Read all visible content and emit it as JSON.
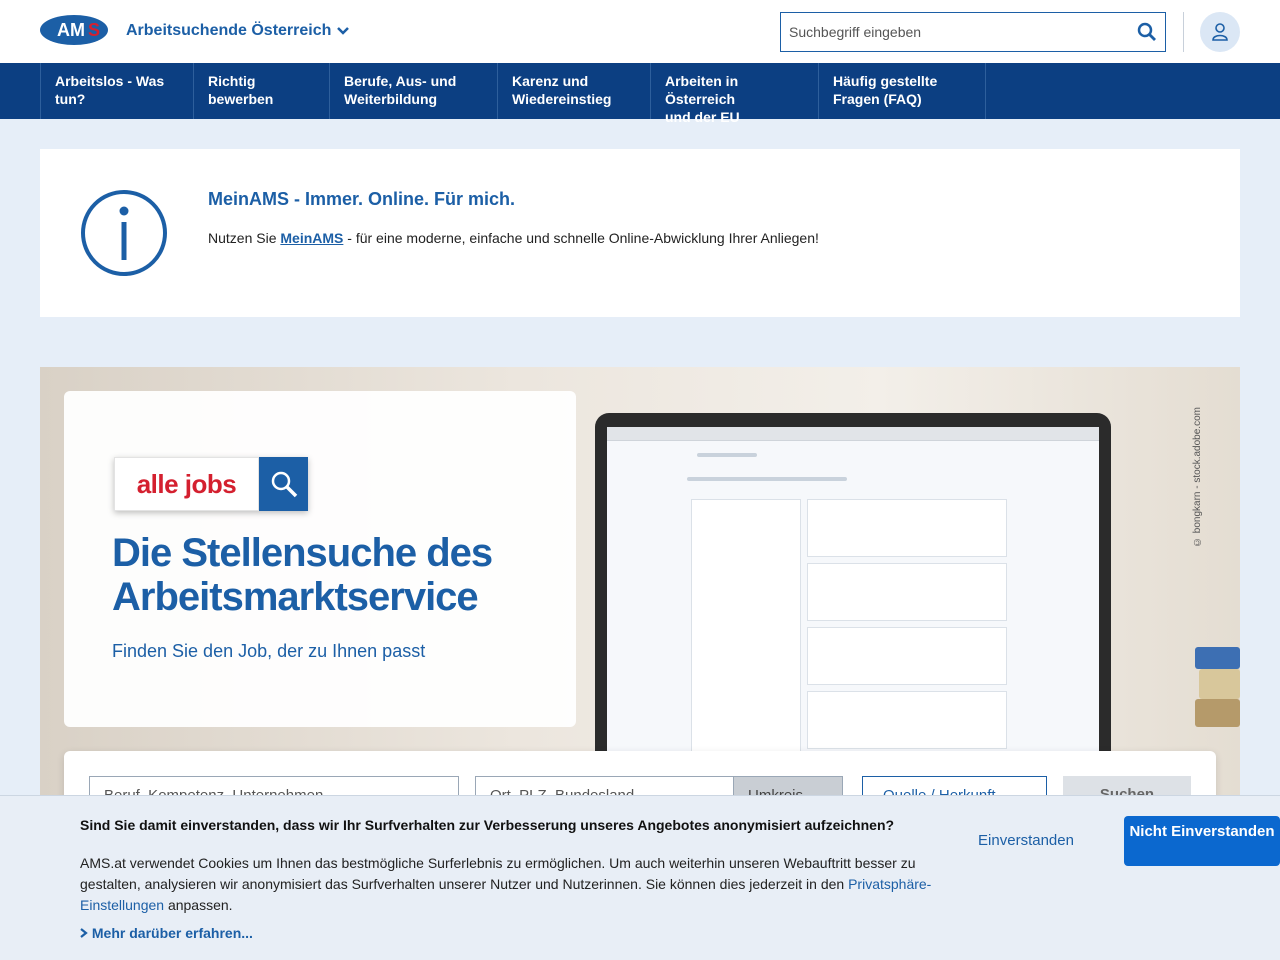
{
  "header": {
    "logo_text": "AMS",
    "region_label": "Arbeitsuchende Österreich",
    "search_placeholder": "Suchbegriff eingeben"
  },
  "nav": {
    "items": [
      {
        "line1": "Arbeitslos - Was",
        "line2": "tun?"
      },
      {
        "line1": "Richtig",
        "line2": "bewerben"
      },
      {
        "line1": "Berufe, Aus- und",
        "line2": "Weiterbildung"
      },
      {
        "line1": "Karenz und",
        "line2": "Wiedereinstieg"
      },
      {
        "line1": "Arbeiten in Österreich",
        "line2": "und der EU"
      },
      {
        "line1": "Häufig gestellte",
        "line2": "Fragen (FAQ)"
      }
    ]
  },
  "info": {
    "title": "MeinAMS - Immer. Online. Für mich.",
    "text_before": "Nutzen Sie ",
    "link": "MeinAMS",
    "text_after": " - für eine moderne, einfache und schnelle Online-Abwicklung Ihrer Anliegen!"
  },
  "hero": {
    "logo_text": "alle jobs",
    "headline": "Die Stellensuche des Arbeitsmarktservice",
    "tagline": "Finden Sie den Job, der zu Ihnen passt",
    "photo_credit": "© bongkarn - stock.adobe.com"
  },
  "jobsearch": {
    "keyword_placeholder": "Beruf, Kompetenz, Unternehmen",
    "location_placeholder": "Ort, PLZ, Bundesland",
    "radius_label": "Umkreis",
    "source_label": "Quelle / Herkunft",
    "search_button": "Suchen"
  },
  "cookie": {
    "question": "Sind Sie damit einverstanden, dass wir Ihr Surfverhalten zur Verbesserung unseres Angebotes anonymisiert aufzeichnen?",
    "text_before": "AMS.at verwendet Cookies um Ihnen das bestmögliche Surferlebnis zu  ermöglichen. Um auch weiterhin unseren Webauftritt besser zu gestalten, analysieren wir anonymisiert das Surfverhalten unserer Nutzer und  Nutzerinnen. Sie können dies jederzeit in den ",
    "link": "Privatsphäre-Einstellungen",
    "text_after": " anpassen.",
    "more": "Mehr darüber erfahren...",
    "accept": "Einverstanden",
    "decline": "Nicht Einverstanden"
  },
  "colors": {
    "brand_blue": "#1c5fa6",
    "nav_blue": "#0c3f82",
    "ams_red": "#d4202f",
    "button_blue": "#0b68cf"
  }
}
